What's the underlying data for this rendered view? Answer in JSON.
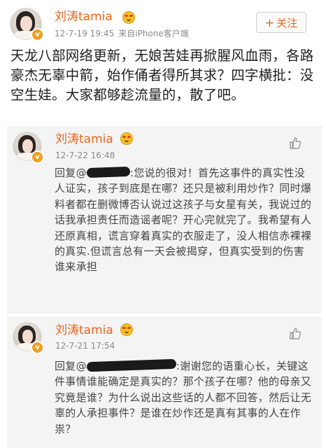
{
  "post": {
    "author": "刘涛tamia",
    "date": "12-7-19 19:45",
    "source": "来自iPhone客户端",
    "follow_label": "关注",
    "follow_plus": "+",
    "text": "天龙八部网络更新，无娘苦娃再掀腥风血雨，各路豪杰无辜中箭，始作俑者得所其求？四字横批：没空生娃。大家都够趁流量的，散了吧。"
  },
  "replies": [
    {
      "author": "刘涛tamia",
      "date": "12-7-22 16:48",
      "prefix": "回复@",
      "text": ":您说的很对！首先这事件的真实性没人证实，孩子到底是在哪？还只是被利用炒作？同时爆料者都在删微博否认说过这孩子与女星有关，我说过的话我承担责任而造谣者呢？开心完就完了。我希望有人还原真相，谎言穿着真实的衣服走了，没人相信赤裸裸的真实.但谎言总有一天会被揭穿，但真实受到的伤害谁来承担"
    },
    {
      "author": "刘涛tamia",
      "date": "12-7-21 17:54",
      "prefix": "回复@",
      "text": ":谢谢您的语重心长，关键这件事情谁能确定是真实的？那个孩子在哪？他的母亲又究竟是谁？为什么说出这些话的人都不回答，然后让无辜的人承担事件？是谁在炒作还是真有其事的人在作祟？"
    }
  ],
  "icons": {
    "verified": "verified-v-badge-icon",
    "emoji": "crown-face-emoji-icon",
    "like": "thumbs-up-icon"
  },
  "colors": {
    "name": "#e8641b",
    "meta": "#8a8a8a",
    "card_bg": "#f4f4f4",
    "verified": "#f0a020"
  }
}
